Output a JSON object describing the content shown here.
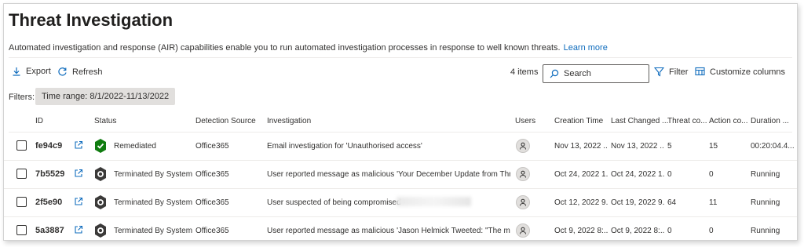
{
  "page": {
    "title": "Threat Investigation",
    "description": "Automated investigation and response (AIR) capabilities enable you to run automated investigation processes in response to well known threats.",
    "learn_more": "Learn more"
  },
  "toolbar": {
    "export_label": "Export",
    "refresh_label": "Refresh",
    "items_count": "4 items",
    "search_placeholder": "Search",
    "filter_label": "Filter",
    "customize_label": "Customize columns"
  },
  "filters": {
    "label": "Filters:",
    "chip": "Time range: 8/1/2022-11/13/2022"
  },
  "columns": [
    "ID",
    "Status",
    "Detection Source",
    "Investigation",
    "Users",
    "Creation Time",
    "Last Changed ...",
    "Threat co...",
    "Action co...",
    "Duration ..."
  ],
  "rows": [
    {
      "id": "fe94c9",
      "status": "Remediated",
      "status_color": "#107c10",
      "source": "Office365",
      "investigation": "Email investigation for 'Unauthorised access'",
      "created": "Nov 13, 2022 ...",
      "changed": "Nov 13, 2022 ...",
      "threat": "5",
      "action": "15",
      "duration": "00:20:04.4..."
    },
    {
      "id": "7b5529",
      "status": "Terminated By System",
      "status_color": "#323130",
      "source": "Office365",
      "investigation": "User reported message as malicious 'Your December Update from Three ...' f...",
      "created": "Oct 24, 2022 1...",
      "changed": "Oct 24, 2022 1...",
      "threat": "0",
      "action": "0",
      "duration": "Running"
    },
    {
      "id": "2f5e90",
      "status": "Terminated By System",
      "status_color": "#323130",
      "source": "Office365",
      "investigation": "User suspected of being compromised -",
      "created": "Oct 12, 2022 9...",
      "changed": "Oct 19, 2022 9...",
      "threat": "64",
      "action": "11",
      "duration": "Running"
    },
    {
      "id": "5a3887",
      "status": "Terminated By System",
      "status_color": "#323130",
      "source": "Office365",
      "investigation": "User reported message as malicious 'Jason Helmick Tweeted: \"The mous...' f...",
      "created": "Oct 9, 2022 8:...",
      "changed": "Oct 9, 2022 8:...",
      "threat": "0",
      "action": "0",
      "duration": "Running"
    }
  ]
}
